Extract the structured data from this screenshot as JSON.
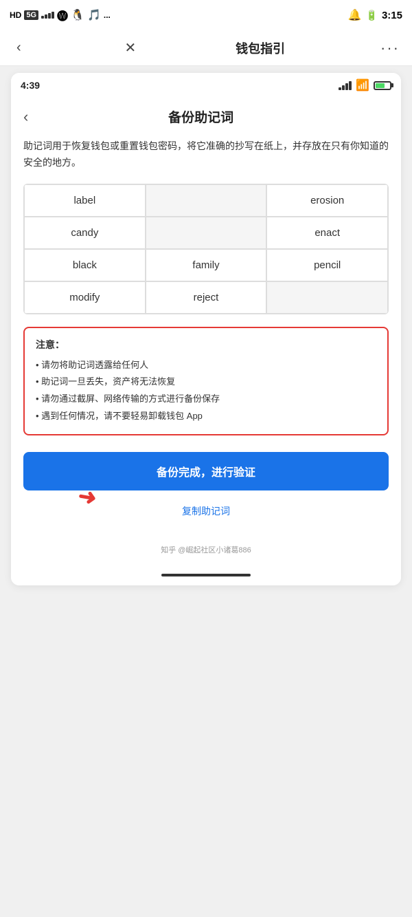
{
  "outer": {
    "status": {
      "network": "HD 5G",
      "signal_bars": [
        3,
        5,
        7,
        9,
        11
      ],
      "time": "3:15",
      "battery_percent": 70
    },
    "nav": {
      "back_label": "‹",
      "close_label": "✕",
      "title": "钱包指引",
      "more_label": "···"
    }
  },
  "inner": {
    "status": {
      "time": "4:39"
    },
    "nav": {
      "back_label": "‹",
      "title": "备份助记词"
    },
    "description": "助记词用于恢复钱包或重置钱包密码，将它准确的抄写在纸上，并存放在只有你知道的安全的地方。",
    "mnemonic_words": [
      {
        "word": "label",
        "col": 0
      },
      {
        "word": "",
        "col": 1
      },
      {
        "word": "erosion",
        "col": 2
      },
      {
        "word": "candy",
        "col": 0
      },
      {
        "word": "",
        "col": 1
      },
      {
        "word": "enact",
        "col": 2
      },
      {
        "word": "black",
        "col": 0
      },
      {
        "word": "family",
        "col": 1
      },
      {
        "word": "pencil",
        "col": 2
      },
      {
        "word": "modify",
        "col": 0
      },
      {
        "word": "reject",
        "col": 1
      },
      {
        "word": "",
        "col": 2
      }
    ],
    "warning": {
      "title": "注意：",
      "items": [
        "• 请勿将助记词透露给任何人",
        "• 助记词一旦丢失，资产将无法恢复",
        "• 请勿通过截屏、网络传输的方式进行备份保存",
        "• 遇到任何情况，请不要轻易卸载钱包 App"
      ]
    },
    "button": {
      "main_label": "备份完成，进行验证",
      "copy_label": "复制助记词"
    }
  },
  "watermark": {
    "text": "知乎 @崛起社区小诸葛886"
  }
}
